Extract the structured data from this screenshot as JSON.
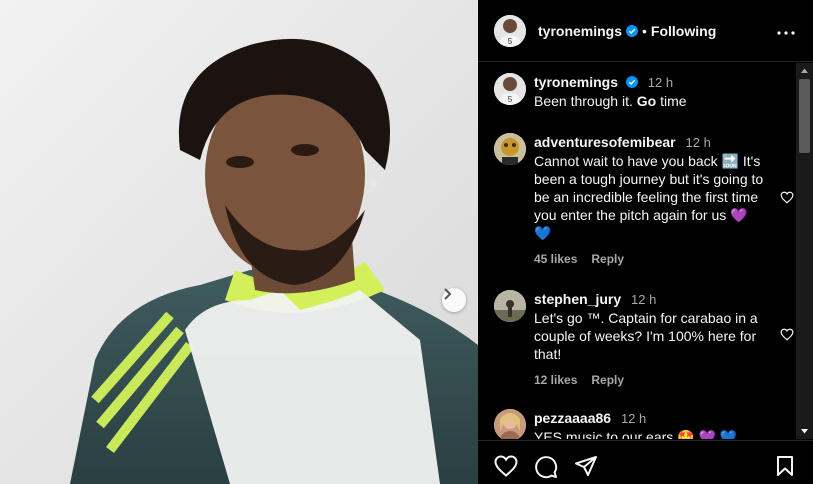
{
  "post": {
    "author": "tyronemings",
    "follow_separator": "•",
    "follow_status": "Following",
    "more_icon": "more-options-icon"
  },
  "comments": [
    {
      "username": "tyronemings",
      "time": "12 h",
      "verified": true,
      "text_plain": "Been through it. ",
      "text_bold": "Go",
      "text_tail": " time"
    },
    {
      "username": "adventuresofemibear",
      "time": "12 h",
      "text": "Cannot wait to have you back",
      "emoji1": "🔜",
      "text2": "It's been a tough journey but it's going to be an incredible feeling the first time you enter the pitch again for us",
      "emoji2": "💜 💙",
      "likes": "45 likes",
      "reply": "Reply"
    },
    {
      "username": "stephen_jury",
      "time": "12 h",
      "text": "Let's go ™. Captain for carabao in a couple of weeks? I'm 100% here for that!",
      "likes": "12 likes",
      "reply": "Reply"
    },
    {
      "username": "pezzaaaa86",
      "time": "12 h",
      "text": "YES music to our ears 🤩 💜 💙"
    }
  ],
  "colors": {
    "verified": "#0095f6",
    "background": "#000000",
    "muted": "#a8a8a8"
  }
}
